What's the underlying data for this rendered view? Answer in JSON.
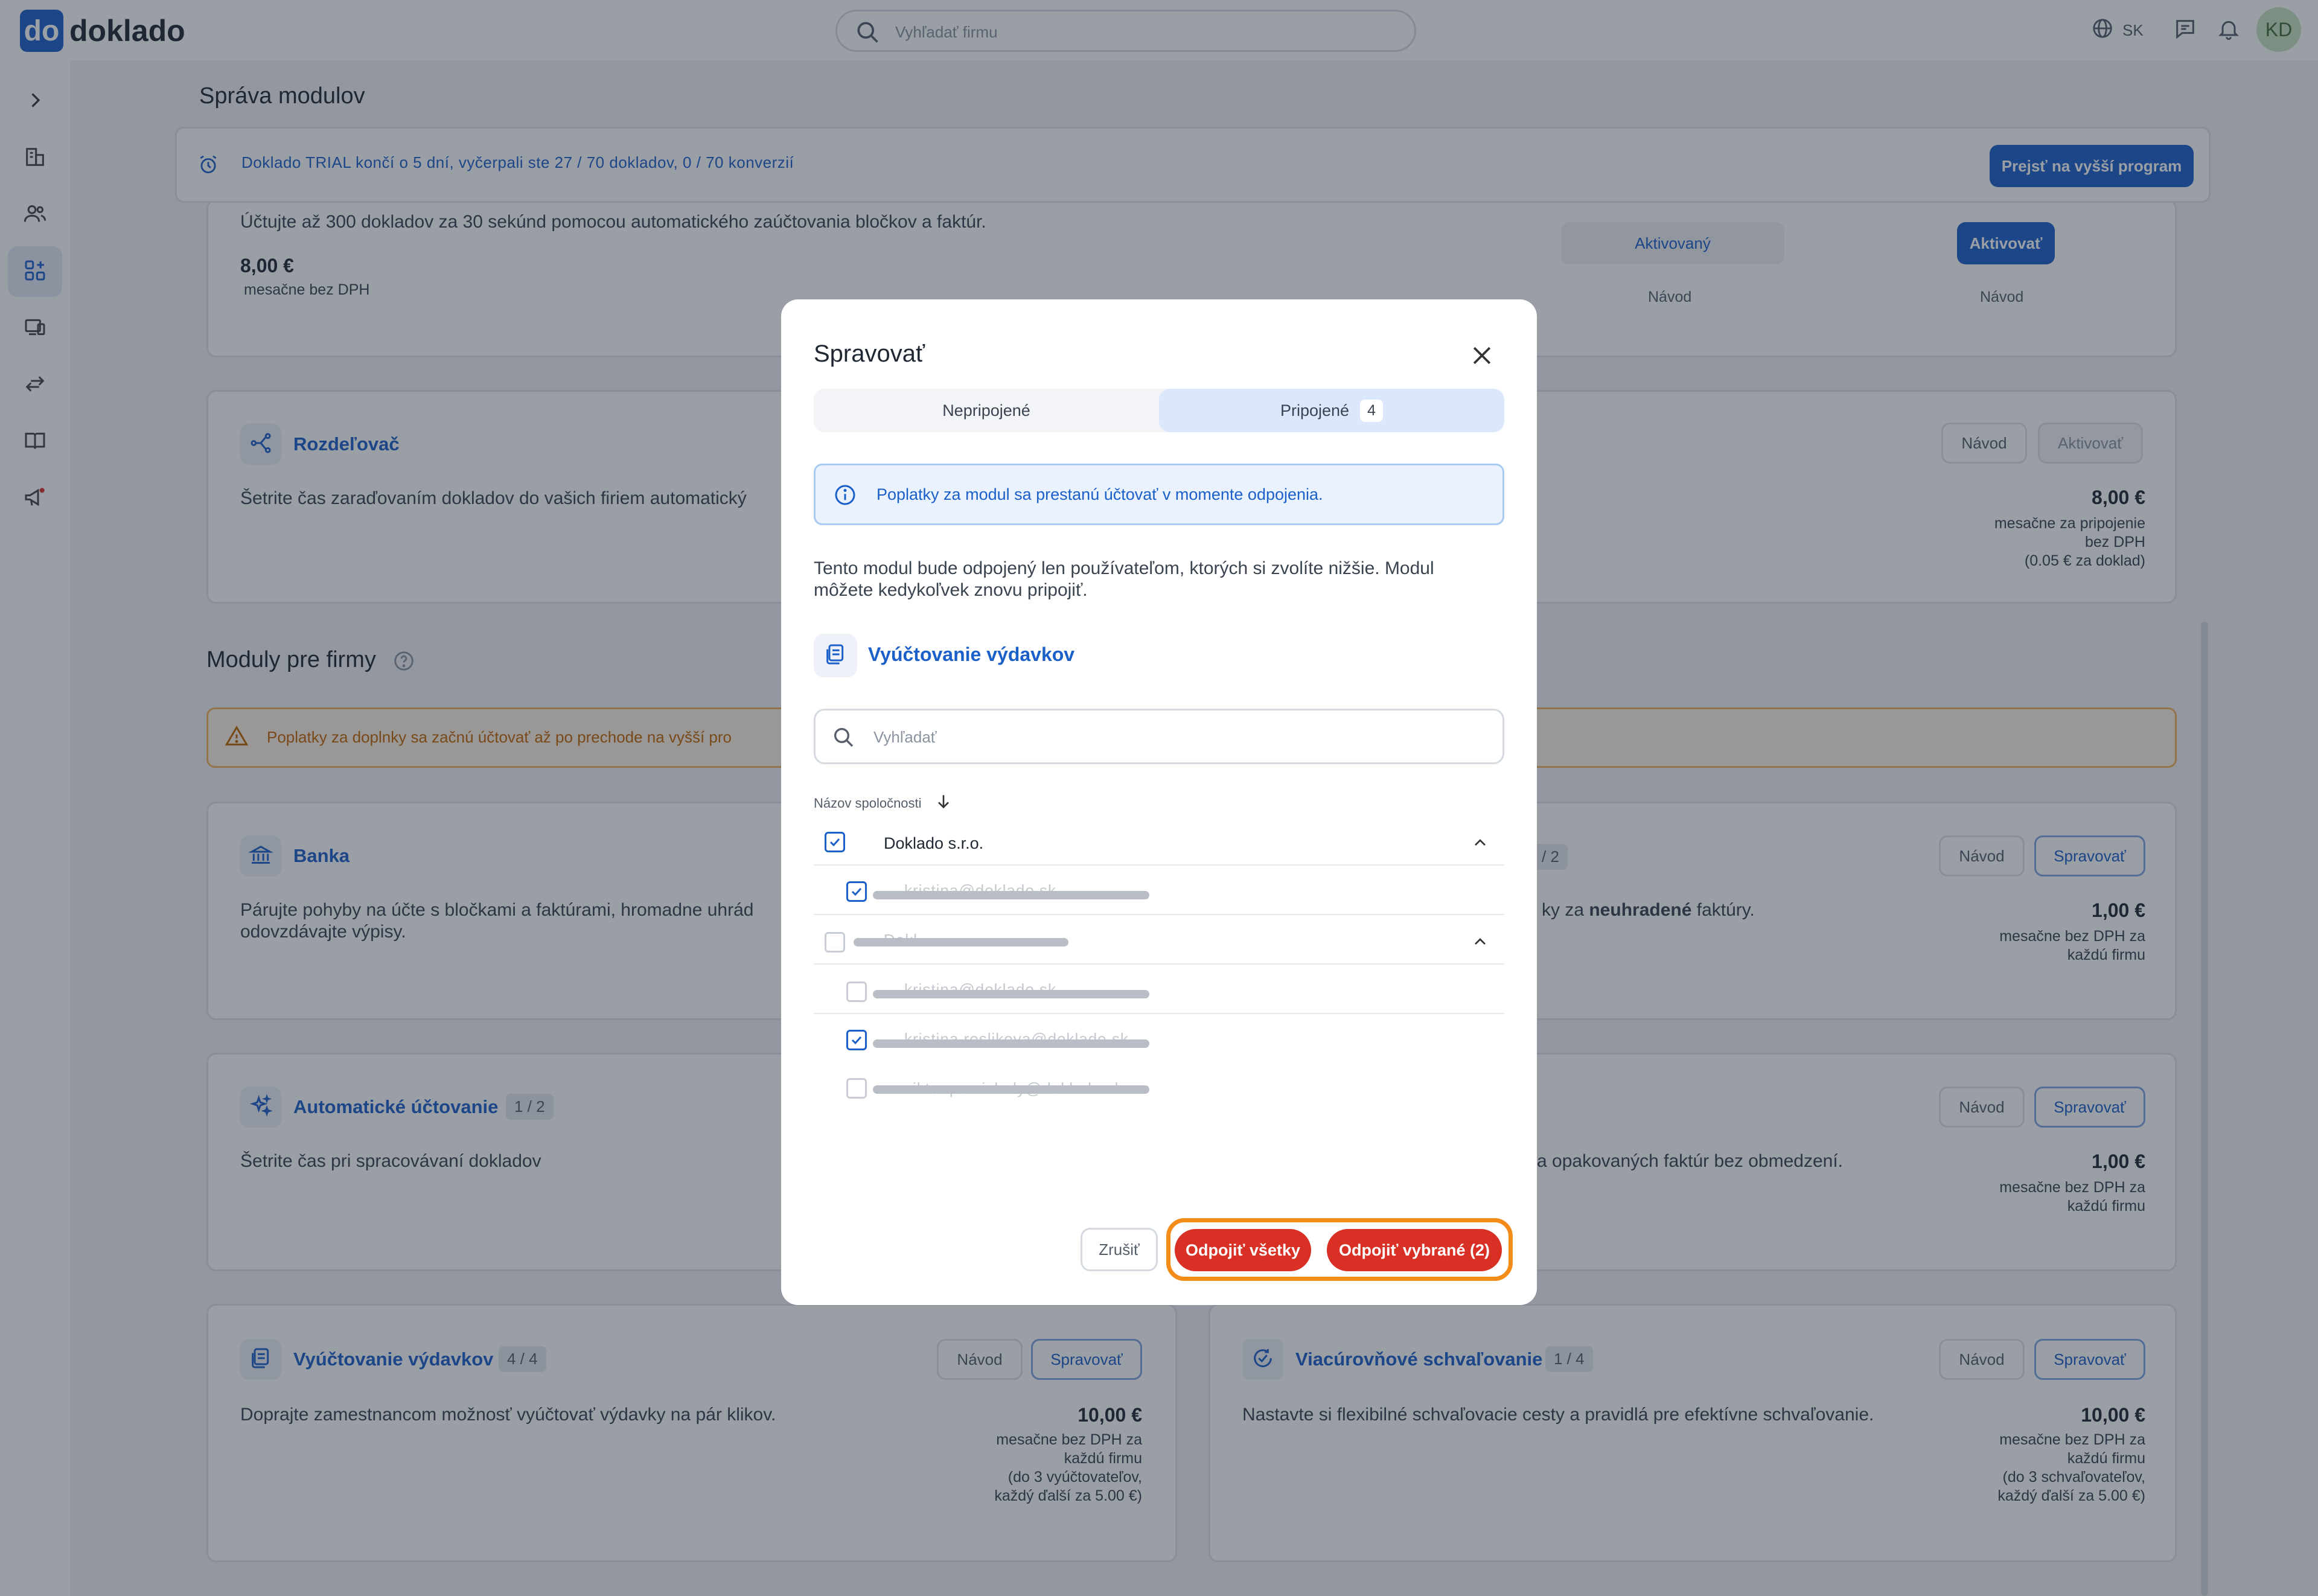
{
  "app": {
    "logo_mark": "do",
    "logo_text": "doklado"
  },
  "header": {
    "search_placeholder": "Vyhľadať firmu",
    "language": "SK",
    "avatar_initials": "KD"
  },
  "page": {
    "title": "Správa modulov"
  },
  "trial": {
    "text": "Doklado TRIAL končí o 5 dní, vyčerpali ste 27 / 70 dokladov, 0 / 70 konverzií",
    "upgrade_label": "Prejsť na vyšší program"
  },
  "top_card": {
    "desc": "Účtujte až 300 dokladov za 30 sekúnd pomocou automatického zaúčtovania bločkov a faktúr.",
    "price": "8,00 €",
    "price_note": "mesačne bez DPH",
    "activated_label": "Aktivovaný",
    "activate_label": "Aktivovať",
    "guide_left": "Návod",
    "guide_right": "Návod"
  },
  "splitter_card": {
    "title": "Rozdeľovač",
    "desc": "Šetrite čas zaraďovaním dokladov do vašich firiem automatický",
    "guide": "Návod",
    "activate": "Aktivovať",
    "price": "8,00 €",
    "note1": "mesačne za pripojenie",
    "note2": "bez DPH",
    "note3": "(0.05 € za doklad)"
  },
  "section": {
    "title": "Moduly pre firmy",
    "warning": "Poplatky za doplnky sa začnú účtovať až po prechode na vyšší pro"
  },
  "cards": {
    "bank": {
      "title": "Banka",
      "desc1": "Párujte pohyby na účte s bločkami a faktúrami, hromadne uhrád",
      "desc2": "odovzdávajte výpisy."
    },
    "right1": {
      "badge": "/ 2",
      "desc_pre": "ky za ",
      "desc_bold": "neuhradené",
      "desc_post": " faktúry.",
      "guide": "Návod",
      "manage": "Spravovať",
      "price": "1,00 €",
      "note1": "mesačne bez DPH za",
      "note2": "každú firmu"
    },
    "auto": {
      "title": "Automatické účtovanie",
      "badge": "1 / 2",
      "desc": "Šetrite čas pri spracovávaní dokladov"
    },
    "right2": {
      "desc": "a opakovaných faktúr bez obmedzení.",
      "guide": "Návod",
      "manage": "Spravovať",
      "price": "1,00 €",
      "note1": "mesačne bez DPH za",
      "note2": "každú firmu"
    },
    "expenses": {
      "title": "Vyúčtovanie výdavkov",
      "badge": "4 / 4",
      "desc": "Doprajte zamestnancom možnosť vyúčtovať výdavky na pár klikov.",
      "guide": "Návod",
      "manage": "Spravovať",
      "price": "10,00 €",
      "note1": "mesačne bez DPH za",
      "note2": "každú firmu",
      "note3": "(do 3 vyúčtovateľov,",
      "note4": "každý ďalší za 5.00 €)"
    },
    "approval": {
      "title": "Viacúrovňové schvaľovanie",
      "badge": "1 / 4",
      "desc": "Nastavte si flexibilné schvaľovacie cesty a pravidlá pre efektívne schvaľovanie.",
      "guide": "Návod",
      "manage": "Spravovať",
      "price": "10,00 €",
      "note1": "mesačne bez DPH za",
      "note2": "každú firmu",
      "note3": "(do 3 schvaľovateľov,",
      "note4": "každý ďalší za 5.00 €)"
    }
  },
  "modal": {
    "title": "Spravovať",
    "tab_unlinked": "Nepripojené",
    "tab_linked": "Pripojené",
    "tab_linked_count": "4",
    "info": "Poplatky za modul sa prestanú účtovať v momente odpojenia.",
    "description": "Tento modul bude odpojený len používateľom, ktorých si zvolíte nižšie. Modul môžete kedykoľvek znovu pripojiť.",
    "module_name": "Vyúčtovanie výdavkov",
    "search_placeholder": "Vyhľadať",
    "column_header": "Názov spoločnosti",
    "company1": "Doklado s.r.o.",
    "user1": "kristina@doklado.sk",
    "company2": "Dokl...",
    "user2": "kristina@doklado.sk",
    "user3": "kristina.roslikova@doklado.sk",
    "user4": "viktor.pomichaly@doklado.sk",
    "cancel": "Zrušiť",
    "disconnect_all": "Odpojiť všetky",
    "disconnect_selected": "Odpojiť vybrané (2)"
  },
  "colors": {
    "brand": "#1b5fc9",
    "danger": "#d93025",
    "highlight": "#f48c1a"
  }
}
